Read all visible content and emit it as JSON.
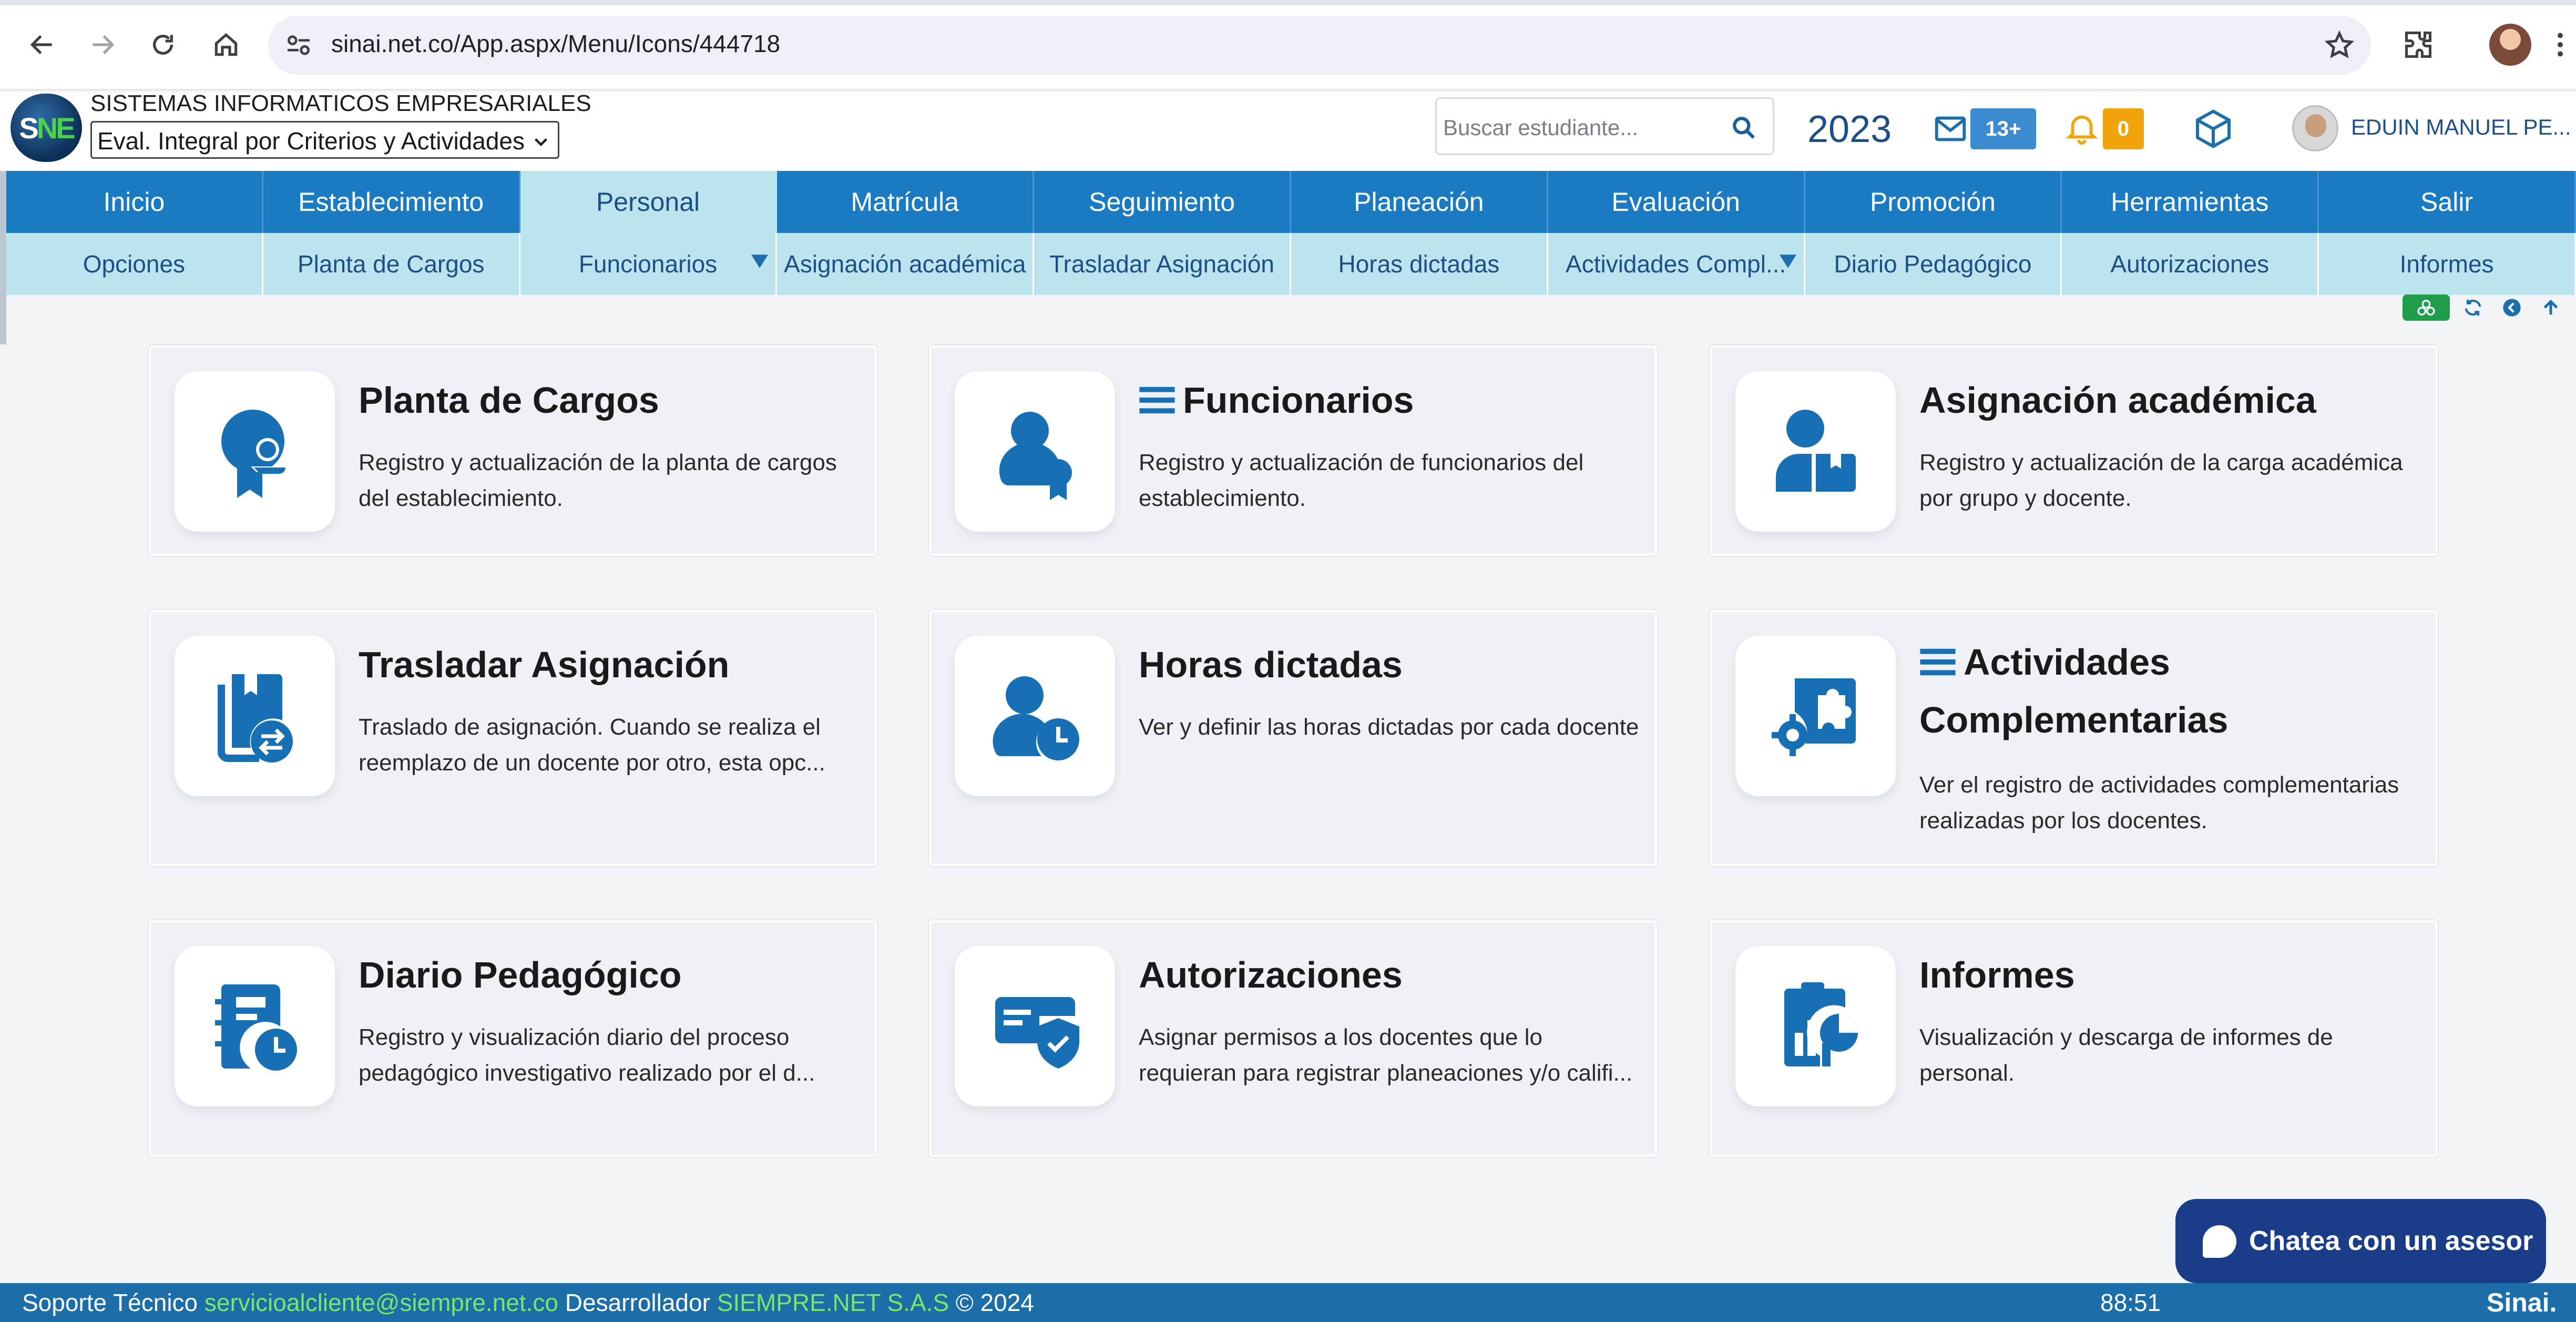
{
  "browser": {
    "url": "sinai.net.co/App.aspx/Menu/Icons/444718"
  },
  "header": {
    "logo_text": "SNE",
    "company_name": "SISTEMAS INFORMATICOS EMPRESARIALES",
    "system_selected": "Eval. Integral por Criterios y Actividades",
    "search_placeholder": "Buscar estudiante...",
    "year": "2023",
    "mail_badge": "13+",
    "bell_badge": "0",
    "user_name": "EDUIN MANUEL PE..."
  },
  "main_menu": [
    {
      "label": "Inicio",
      "active": false
    },
    {
      "label": "Establecimiento",
      "active": false
    },
    {
      "label": "Personal",
      "active": true
    },
    {
      "label": "Matrícula",
      "active": false
    },
    {
      "label": "Seguimiento",
      "active": false
    },
    {
      "label": "Planeación",
      "active": false
    },
    {
      "label": "Evaluación",
      "active": false
    },
    {
      "label": "Promoción",
      "active": false
    },
    {
      "label": "Herramientas",
      "active": false
    },
    {
      "label": "Salir",
      "active": false
    }
  ],
  "sub_menu": [
    {
      "label": "Opciones"
    },
    {
      "label": "Planta de Cargos"
    },
    {
      "label": "Funcionarios"
    },
    {
      "label": "Asignación académica"
    },
    {
      "label": "Trasladar Asignación"
    },
    {
      "label": "Horas dictadas"
    },
    {
      "label": "Actividades Compl..."
    },
    {
      "label": "Diario Pedagógico"
    },
    {
      "label": "Autorizaciones"
    },
    {
      "label": "Informes"
    }
  ],
  "cards": [
    {
      "title": "Planta de Cargos",
      "desc": "Registro y actualización de la planta de cargos del establecimiento.",
      "icon": "badge-person-icon"
    },
    {
      "title": "Funcionarios",
      "desc": "Registro y actualización de funcionarios del establecimiento.",
      "icon": "person-award-icon"
    },
    {
      "title": "Asignación académica",
      "desc": "Registro y actualización de la carga académica por grupo y docente.",
      "icon": "person-book-icon"
    },
    {
      "title": "Trasladar Asignación",
      "desc": "Traslado de asignación. Cuando se realiza el reemplazo de un docente por otro, esta opc...",
      "icon": "book-transfer-icon"
    },
    {
      "title": "Horas dictadas",
      "desc": "Ver y definir las horas dictadas por cada docente",
      "icon": "person-clock-icon"
    },
    {
      "title": "Actividades Complementarias",
      "desc": "Ver el registro de actividades complementarias realizadas por los docentes.",
      "icon": "puzzle-gear-icon"
    },
    {
      "title": "Diario Pedagógico",
      "desc": "Registro y visualización diario del proceso pedagógico investigativo realizado por el d...",
      "icon": "notebook-clock-icon"
    },
    {
      "title": "Autorizaciones",
      "desc": "Asignar permisos a los docentes que lo requieran para registrar planeaciones y/o califi...",
      "icon": "card-shield-icon"
    },
    {
      "title": "Informes",
      "desc": "Visualización y descarga de informes de personal.",
      "icon": "report-chart-icon"
    }
  ],
  "chat": {
    "label": "Chatea con un asesor"
  },
  "footer": {
    "support_label": "Soporte Técnico",
    "support_email": "servicioalcliente@siempre.net.co",
    "developer_label": "Desarrollador",
    "developer_name": "SIEMPRE.NET S.A.S",
    "copyright": "© 2024",
    "timer": "88:51",
    "brand": "Sinai."
  },
  "colors": {
    "menu_blue": "#1b7bc2",
    "menu_active": "#bce3ee",
    "icon_blue": "#1770b3",
    "footer_blue": "#1b6ea8",
    "chat_navy": "#1a3d8a"
  }
}
